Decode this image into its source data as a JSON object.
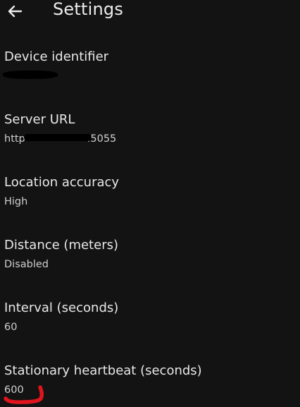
{
  "appbar": {
    "back_icon": "arrow-left-icon",
    "title": "Settings"
  },
  "settings": {
    "items": [
      {
        "title": "Device identifier",
        "value": ""
      },
      {
        "title": "Server URL",
        "value": "http",
        "value_suffix": ".5055"
      },
      {
        "title": "Location accuracy",
        "value": "High"
      },
      {
        "title": "Distance (meters)",
        "value": "Disabled"
      },
      {
        "title": "Interval (seconds)",
        "value": "60"
      },
      {
        "title": "Stationary heartbeat (seconds)",
        "value": "600"
      }
    ]
  },
  "colors": {
    "background": "#131313",
    "title_text": "#e8e8e8",
    "value_text": "#cfcfcf",
    "annotation_red": "#e0141e"
  }
}
